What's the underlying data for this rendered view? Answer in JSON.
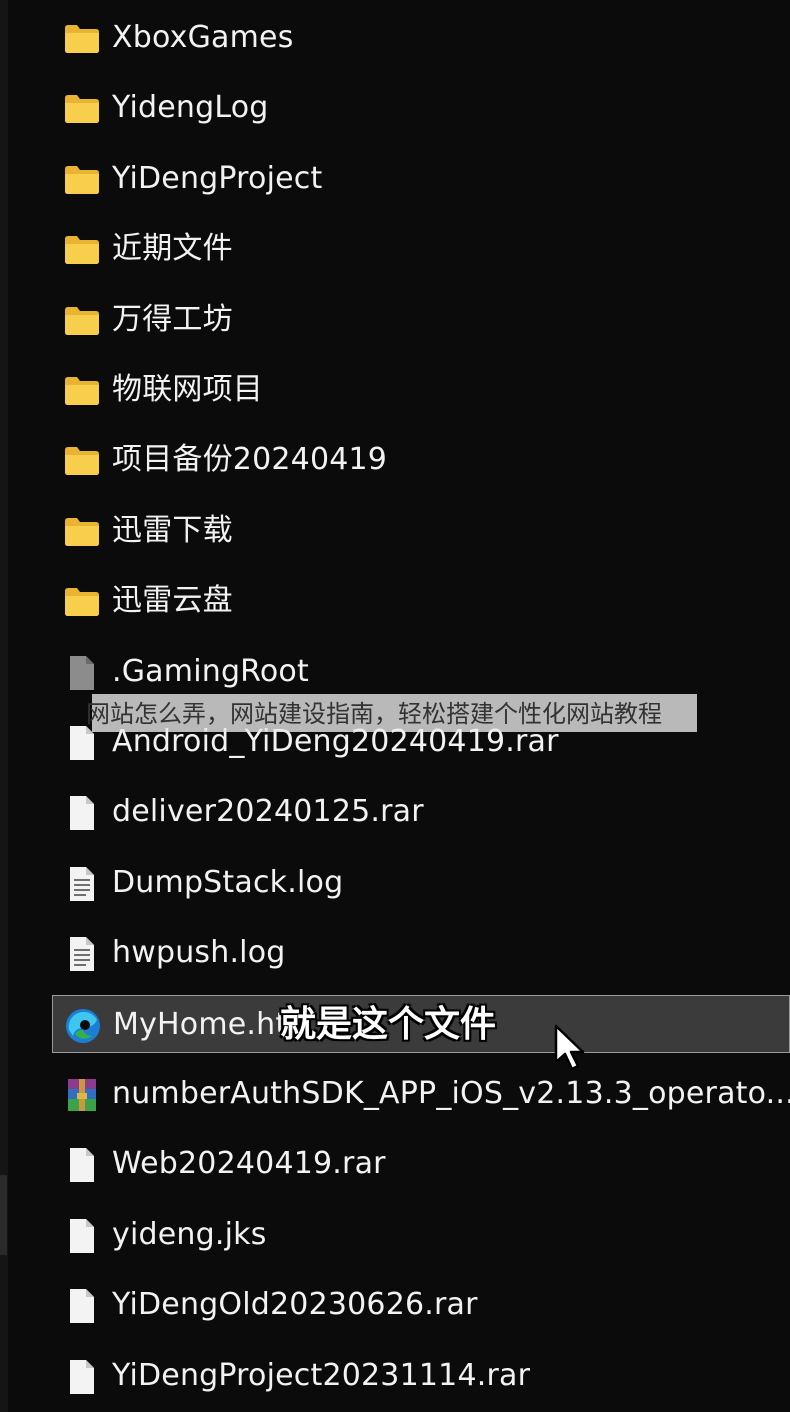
{
  "files": [
    {
      "name": "XboxGames",
      "icon": "folder-icon"
    },
    {
      "name": "YidengLog",
      "icon": "folder-icon"
    },
    {
      "name": "YiDengProject",
      "icon": "folder-icon"
    },
    {
      "name": "近期文件",
      "icon": "folder-icon"
    },
    {
      "name": "万得工坊",
      "icon": "folder-icon"
    },
    {
      "name": "物联网项目",
      "icon": "folder-icon"
    },
    {
      "name": "项目备份20240419",
      "icon": "folder-icon"
    },
    {
      "name": "迅雷下载",
      "icon": "folder-icon"
    },
    {
      "name": "迅雷云盘",
      "icon": "folder-icon"
    },
    {
      "name": ".GamingRoot",
      "icon": "system-file-icon"
    },
    {
      "name": "Android_YiDeng20240419.rar",
      "icon": "blank-file-icon"
    },
    {
      "name": "deliver20240125.rar",
      "icon": "blank-file-icon"
    },
    {
      "name": "DumpStack.log",
      "icon": "text-file-icon"
    },
    {
      "name": "hwpush.log",
      "icon": "text-file-icon"
    },
    {
      "name": "MyHome.ht",
      "icon": "edge-browser-icon",
      "selected": true
    },
    {
      "name": "numberAuthSDK_APP_iOS_v2.13.3_operato...",
      "icon": "winrar-archive-icon"
    },
    {
      "name": "Web20240419.rar",
      "icon": "blank-file-icon"
    },
    {
      "name": "yideng.jks",
      "icon": "blank-file-icon"
    },
    {
      "name": "YiDengOld20230626.rar",
      "icon": "blank-file-icon"
    },
    {
      "name": "YiDengProject20231114.rar",
      "icon": "blank-file-icon"
    }
  ],
  "overlay_banner": "网站怎么弄，网站建设指南，轻松搭建个性化网站教程",
  "video_subtitle": "就是这个文件",
  "colors": {
    "background": "#0b0b0b",
    "selected_row": "#3b3b3b",
    "selected_border": "#9a9a9a",
    "folder": "#f6c945",
    "text": "#f2f2f2"
  }
}
